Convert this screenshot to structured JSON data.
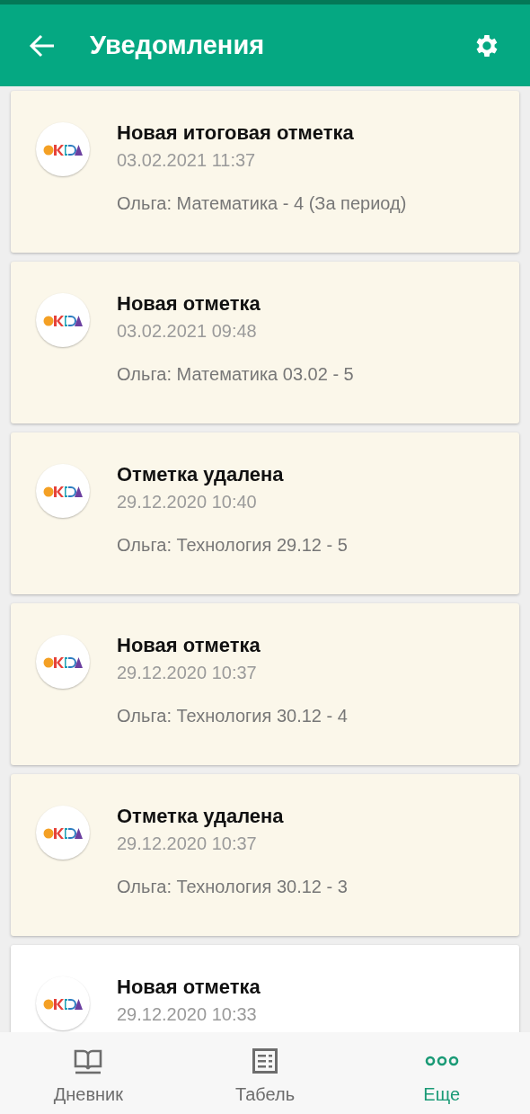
{
  "app_bar": {
    "title": "Уведомления"
  },
  "notifications": [
    {
      "title": "Новая итоговая отметка",
      "time": "03.02.2021 11:37",
      "message": "Ольга: Математика - 4 (За период)",
      "unread": true
    },
    {
      "title": "Новая отметка",
      "time": "03.02.2021 09:48",
      "message": "Ольга: Математика 03.02 - 5",
      "unread": true
    },
    {
      "title": "Отметка удалена",
      "time": "29.12.2020 10:40",
      "message": "Ольга: Технология 29.12 - 5",
      "unread": true
    },
    {
      "title": "Новая отметка",
      "time": "29.12.2020 10:37",
      "message": "Ольга: Технология 30.12 - 4",
      "unread": true
    },
    {
      "title": "Отметка удалена",
      "time": "29.12.2020 10:37",
      "message": "Ольга: Технология 30.12 - 3",
      "unread": true
    },
    {
      "title": "Новая отметка",
      "time": "29.12.2020 10:33",
      "unread": false
    }
  ],
  "bottom_nav": [
    {
      "label": "Дневник",
      "kind": "book",
      "selected": false
    },
    {
      "label": "Табель",
      "kind": "table",
      "selected": false
    },
    {
      "label": "Еще",
      "kind": "more",
      "selected": true
    }
  ]
}
